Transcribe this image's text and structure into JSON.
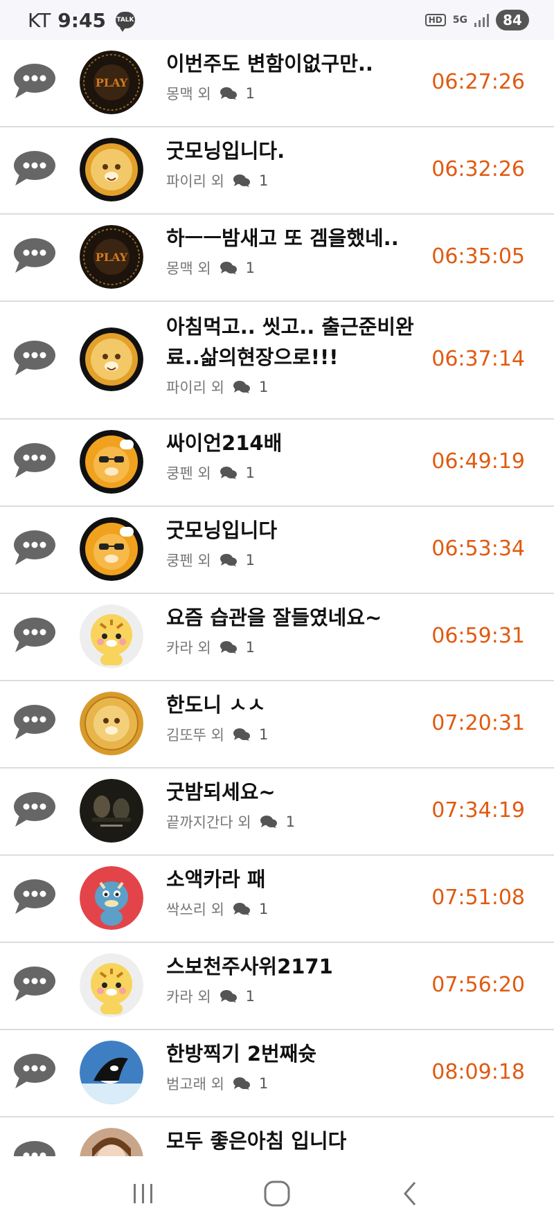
{
  "status_bar": {
    "carrier": "KT",
    "time": "9:45",
    "talk_badge": "TALK",
    "hd": "HD",
    "network": "5G",
    "battery": "84"
  },
  "colors": {
    "time_accent": "#e05a10",
    "icon_gray": "#666666",
    "divider": "#dcdcdc"
  },
  "posts": [
    {
      "title": "이번주도 변함이없구만..",
      "author": "몽맥 외",
      "comments": "1",
      "time": "06:27:26",
      "avatar": "play-logo"
    },
    {
      "title": "굿모닝입니다.",
      "author": "파이리 외",
      "comments": "1",
      "time": "06:32:26",
      "avatar": "tiger-gold"
    },
    {
      "title": "하ㅡㅡ밤새고 또 겜을했네..",
      "author": "몽맥 외",
      "comments": "1",
      "time": "06:35:05",
      "avatar": "play-logo"
    },
    {
      "title": "아침먹고.. 씻고.. 출근준비완료..삶의현장으로!!!",
      "author": "파이리 외",
      "comments": "1",
      "time": "06:37:14",
      "avatar": "tiger-gold"
    },
    {
      "title": "싸이언214배",
      "author": "쿵펜 외",
      "comments": "1",
      "time": "06:49:19",
      "avatar": "tiger-glasses"
    },
    {
      "title": "굿모닝입니다",
      "author": "쿵펜 외",
      "comments": "1",
      "time": "06:53:34",
      "avatar": "tiger-glasses"
    },
    {
      "title": "요즘 습관을 잘들였네요~",
      "author": "카라 외",
      "comments": "1",
      "time": "06:59:31",
      "avatar": "cute-tiger"
    },
    {
      "title": "한도니 ㅅㅅ",
      "author": "김또뚜 외",
      "comments": "1",
      "time": "07:20:31",
      "avatar": "tiger-coin"
    },
    {
      "title": "굿밤되세요~",
      "author": "끝까지간다 외",
      "comments": "1",
      "time": "07:34:19",
      "avatar": "movie-poster"
    },
    {
      "title": "소액카라 패",
      "author": "싹쓰리 외",
      "comments": "1",
      "time": "07:51:08",
      "avatar": "blue-dragon"
    },
    {
      "title": "스보천주사위2171",
      "author": "카라 외",
      "comments": "1",
      "time": "07:56:20",
      "avatar": "cute-tiger"
    },
    {
      "title": "한방찍기 2번째슛",
      "author": "범고래 외",
      "comments": "1",
      "time": "08:09:18",
      "avatar": "orca"
    },
    {
      "title": "모두 좋은아침 입니다",
      "author": "",
      "comments": "",
      "time": "",
      "avatar": "doll"
    }
  ],
  "nav": {
    "recent": "recent-apps-icon",
    "home": "home-icon",
    "back": "back-icon"
  }
}
